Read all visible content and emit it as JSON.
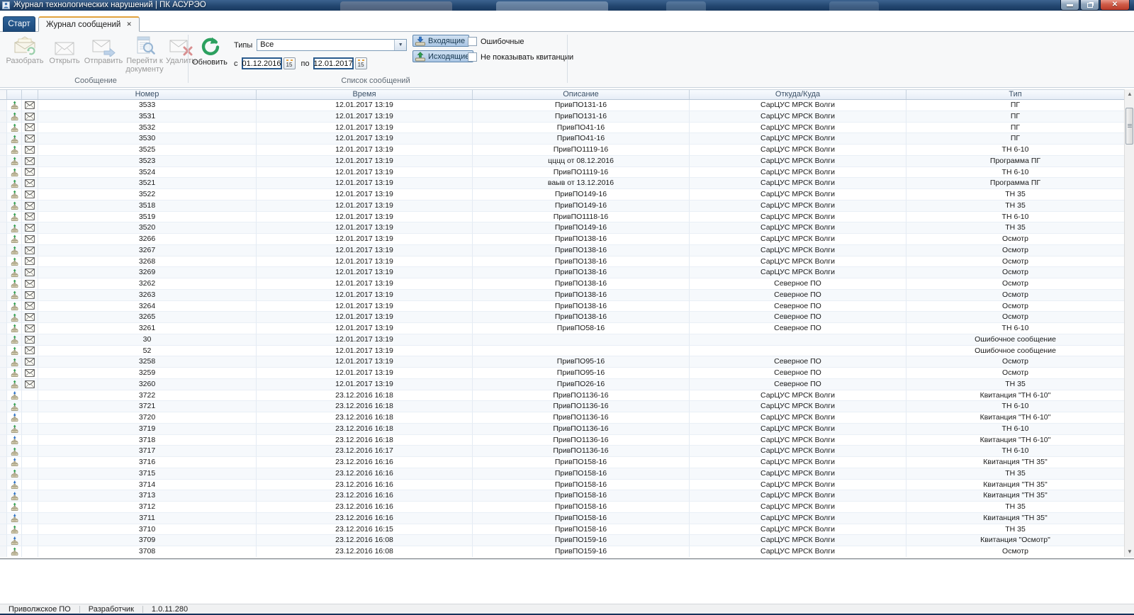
{
  "window": {
    "title": "Журнал технологических нарушений | ПК АСУРЭО",
    "controls": {
      "minimize": "",
      "restore": "",
      "close": "✕"
    }
  },
  "tabs": {
    "start": "Старт",
    "journal": "Журнал сообщений",
    "journal_close": "✕"
  },
  "ribbon": {
    "message_group": {
      "label": "Сообщение",
      "buttons": [
        "Разобрать",
        "Открыть",
        "Отправить",
        "Перейти к документу",
        "Удалить"
      ]
    },
    "list_group": {
      "label": "Список сообщений",
      "refresh_label": "Обновить",
      "types_label": "Типы",
      "types_value": "Все",
      "dropdown_arrow": "▼",
      "from_label": "с",
      "from_value": "01.12.2016",
      "to_label": "по",
      "to_value": "12.01.2017",
      "calendar_day": "15",
      "incoming_label": "Входящие",
      "outgoing_label": "Исходящие",
      "checkbox_error": "Ошибочные",
      "checkbox_receipts": "Не показывать квитанции"
    }
  },
  "table": {
    "columns": [
      "Номер",
      "Время",
      "Описание",
      "Откуда/Куда",
      "Тип"
    ],
    "rows": [
      {
        "num": "3533",
        "time": "12.01.2017 13:19",
        "desc": "ПривПО131-16",
        "from": "СарЦУС МРСК Волги",
        "type": "ПГ",
        "stamp": "green",
        "env": true
      },
      {
        "num": "3531",
        "time": "12.01.2017 13:19",
        "desc": "ПривПО131-16",
        "from": "СарЦУС МРСК Волги",
        "type": "ПГ",
        "stamp": "green",
        "env": true
      },
      {
        "num": "3532",
        "time": "12.01.2017 13:19",
        "desc": "ПривПО41-16",
        "from": "СарЦУС МРСК Волги",
        "type": "ПГ",
        "stamp": "green",
        "env": true
      },
      {
        "num": "3530",
        "time": "12.01.2017 13:19",
        "desc": "ПривПО41-16",
        "from": "СарЦУС МРСК Волги",
        "type": "ПГ",
        "stamp": "green",
        "env": true
      },
      {
        "num": "3525",
        "time": "12.01.2017 13:19",
        "desc": "ПривПО1119-16",
        "from": "СарЦУС МРСК Волги",
        "type": "ТН 6-10",
        "stamp": "green",
        "env": true
      },
      {
        "num": "3523",
        "time": "12.01.2017 13:19",
        "desc": "цццц от 08.12.2016",
        "from": "СарЦУС МРСК Волги",
        "type": "Программа ПГ",
        "stamp": "green",
        "env": true
      },
      {
        "num": "3524",
        "time": "12.01.2017 13:19",
        "desc": "ПривПО1119-16",
        "from": "СарЦУС МРСК Волги",
        "type": "ТН 6-10",
        "stamp": "green",
        "env": true
      },
      {
        "num": "3521",
        "time": "12.01.2017 13:19",
        "desc": "ваыв от 13.12.2016",
        "from": "СарЦУС МРСК Волги",
        "type": "Программа ПГ",
        "stamp": "green",
        "env": true
      },
      {
        "num": "3522",
        "time": "12.01.2017 13:19",
        "desc": "ПривПО149-16",
        "from": "СарЦУС МРСК Волги",
        "type": "ТН 35",
        "stamp": "green",
        "env": true
      },
      {
        "num": "3518",
        "time": "12.01.2017 13:19",
        "desc": "ПривПО149-16",
        "from": "СарЦУС МРСК Волги",
        "type": "ТН 35",
        "stamp": "green",
        "env": true
      },
      {
        "num": "3519",
        "time": "12.01.2017 13:19",
        "desc": "ПривПО1118-16",
        "from": "СарЦУС МРСК Волги",
        "type": "ТН 6-10",
        "stamp": "green",
        "env": true
      },
      {
        "num": "3520",
        "time": "12.01.2017 13:19",
        "desc": "ПривПО149-16",
        "from": "СарЦУС МРСК Волги",
        "type": "ТН 35",
        "stamp": "green",
        "env": true
      },
      {
        "num": "3266",
        "time": "12.01.2017 13:19",
        "desc": "ПривПО138-16",
        "from": "СарЦУС МРСК Волги",
        "type": "Осмотр",
        "stamp": "green",
        "env": true
      },
      {
        "num": "3267",
        "time": "12.01.2017 13:19",
        "desc": "ПривПО138-16",
        "from": "СарЦУС МРСК Волги",
        "type": "Осмотр",
        "stamp": "green",
        "env": true
      },
      {
        "num": "3268",
        "time": "12.01.2017 13:19",
        "desc": "ПривПО138-16",
        "from": "СарЦУС МРСК Волги",
        "type": "Осмотр",
        "stamp": "green",
        "env": true
      },
      {
        "num": "3269",
        "time": "12.01.2017 13:19",
        "desc": "ПривПО138-16",
        "from": "СарЦУС МРСК Волги",
        "type": "Осмотр",
        "stamp": "green",
        "env": true
      },
      {
        "num": "3262",
        "time": "12.01.2017 13:19",
        "desc": "ПривПО138-16",
        "from": "Северное ПО",
        "type": "Осмотр",
        "stamp": "green",
        "env": true
      },
      {
        "num": "3263",
        "time": "12.01.2017 13:19",
        "desc": "ПривПО138-16",
        "from": "Северное ПО",
        "type": "Осмотр",
        "stamp": "green",
        "env": true
      },
      {
        "num": "3264",
        "time": "12.01.2017 13:19",
        "desc": "ПривПО138-16",
        "from": "Северное ПО",
        "type": "Осмотр",
        "stamp": "green",
        "env": true
      },
      {
        "num": "3265",
        "time": "12.01.2017 13:19",
        "desc": "ПривПО138-16",
        "from": "Северное ПО",
        "type": "Осмотр",
        "stamp": "green",
        "env": true
      },
      {
        "num": "3261",
        "time": "12.01.2017 13:19",
        "desc": "ПривПО58-16",
        "from": "Северное ПО",
        "type": "ТН 6-10",
        "stamp": "green",
        "env": true
      },
      {
        "num": "30",
        "time": "12.01.2017 13:19",
        "desc": "",
        "from": "",
        "type": "Ошибочное сообщение",
        "stamp": "green",
        "env": true
      },
      {
        "num": "52",
        "time": "12.01.2017 13:19",
        "desc": "",
        "from": "",
        "type": "Ошибочное сообщение",
        "stamp": "green",
        "env": true
      },
      {
        "num": "3258",
        "time": "12.01.2017 13:19",
        "desc": "ПривПО95-16",
        "from": "Северное ПО",
        "type": "Осмотр",
        "stamp": "green",
        "env": true
      },
      {
        "num": "3259",
        "time": "12.01.2017 13:19",
        "desc": "ПривПО95-16",
        "from": "Северное ПО",
        "type": "Осмотр",
        "stamp": "green",
        "env": true
      },
      {
        "num": "3260",
        "time": "12.01.2017 13:19",
        "desc": "ПривПО26-16",
        "from": "Северное ПО",
        "type": "ТН 35",
        "stamp": "green",
        "env": true
      },
      {
        "num": "3722",
        "time": "23.12.2016 16:18",
        "desc": "ПривПО1136-16",
        "from": "СарЦУС МРСК Волги",
        "type": "Квитанция \"ТН 6-10\"",
        "stamp": "blue",
        "env": false
      },
      {
        "num": "3721",
        "time": "23.12.2016 16:18",
        "desc": "ПривПО1136-16",
        "from": "СарЦУС МРСК Волги",
        "type": "ТН 6-10",
        "stamp": "green",
        "env": false
      },
      {
        "num": "3720",
        "time": "23.12.2016 16:18",
        "desc": "ПривПО1136-16",
        "from": "СарЦУС МРСК Волги",
        "type": "Квитанция \"ТН 6-10\"",
        "stamp": "blue",
        "env": false
      },
      {
        "num": "3719",
        "time": "23.12.2016 16:18",
        "desc": "ПривПО1136-16",
        "from": "СарЦУС МРСК Волги",
        "type": "ТН 6-10",
        "stamp": "green",
        "env": false
      },
      {
        "num": "3718",
        "time": "23.12.2016 16:18",
        "desc": "ПривПО1136-16",
        "from": "СарЦУС МРСК Волги",
        "type": "Квитанция \"ТН 6-10\"",
        "stamp": "blue",
        "env": false
      },
      {
        "num": "3717",
        "time": "23.12.2016 16:17",
        "desc": "ПривПО1136-16",
        "from": "СарЦУС МРСК Волги",
        "type": "ТН 6-10",
        "stamp": "green",
        "env": false
      },
      {
        "num": "3716",
        "time": "23.12.2016 16:16",
        "desc": "ПривПО158-16",
        "from": "СарЦУС МРСК Волги",
        "type": "Квитанция \"ТН 35\"",
        "stamp": "blue",
        "env": false
      },
      {
        "num": "3715",
        "time": "23.12.2016 16:16",
        "desc": "ПривПО158-16",
        "from": "СарЦУС МРСК Волги",
        "type": "ТН 35",
        "stamp": "green",
        "env": false
      },
      {
        "num": "3714",
        "time": "23.12.2016 16:16",
        "desc": "ПривПО158-16",
        "from": "СарЦУС МРСК Волги",
        "type": "Квитанция \"ТН 35\"",
        "stamp": "blue",
        "env": false
      },
      {
        "num": "3713",
        "time": "23.12.2016 16:16",
        "desc": "ПривПО158-16",
        "from": "СарЦУС МРСК Волги",
        "type": "Квитанция \"ТН 35\"",
        "stamp": "blue",
        "env": false
      },
      {
        "num": "3712",
        "time": "23.12.2016 16:16",
        "desc": "ПривПО158-16",
        "from": "СарЦУС МРСК Волги",
        "type": "ТН 35",
        "stamp": "green",
        "env": false
      },
      {
        "num": "3711",
        "time": "23.12.2016 16:16",
        "desc": "ПривПО158-16",
        "from": "СарЦУС МРСК Волги",
        "type": "Квитанция \"ТН 35\"",
        "stamp": "blue",
        "env": false
      },
      {
        "num": "3710",
        "time": "23.12.2016 16:15",
        "desc": "ПривПО158-16",
        "from": "СарЦУС МРСК Волги",
        "type": "ТН 35",
        "stamp": "green",
        "env": false
      },
      {
        "num": "3709",
        "time": "23.12.2016 16:08",
        "desc": "ПривПО159-16",
        "from": "СарЦУС МРСК Волги",
        "type": "Квитанция \"Осмотр\"",
        "stamp": "blue",
        "env": false
      },
      {
        "num": "3708",
        "time": "23.12.2016 16:08",
        "desc": "ПривПО159-16",
        "from": "СарЦУС МРСК Волги",
        "type": "Осмотр",
        "stamp": "green",
        "env": false
      }
    ]
  },
  "status_bar": {
    "items": [
      "Приволжское ПО",
      "Разработчик",
      "1.0.11.280"
    ]
  },
  "colors": {
    "titlebar": "#22456e",
    "active_tab_accent": "#e2a23c",
    "refresh_green": "#2ca05f",
    "toggle_blue": "#aac6e4",
    "header_text": "#3c5168",
    "stamp_green": "#2e9e4f",
    "stamp_blue": "#2a6fc4"
  }
}
